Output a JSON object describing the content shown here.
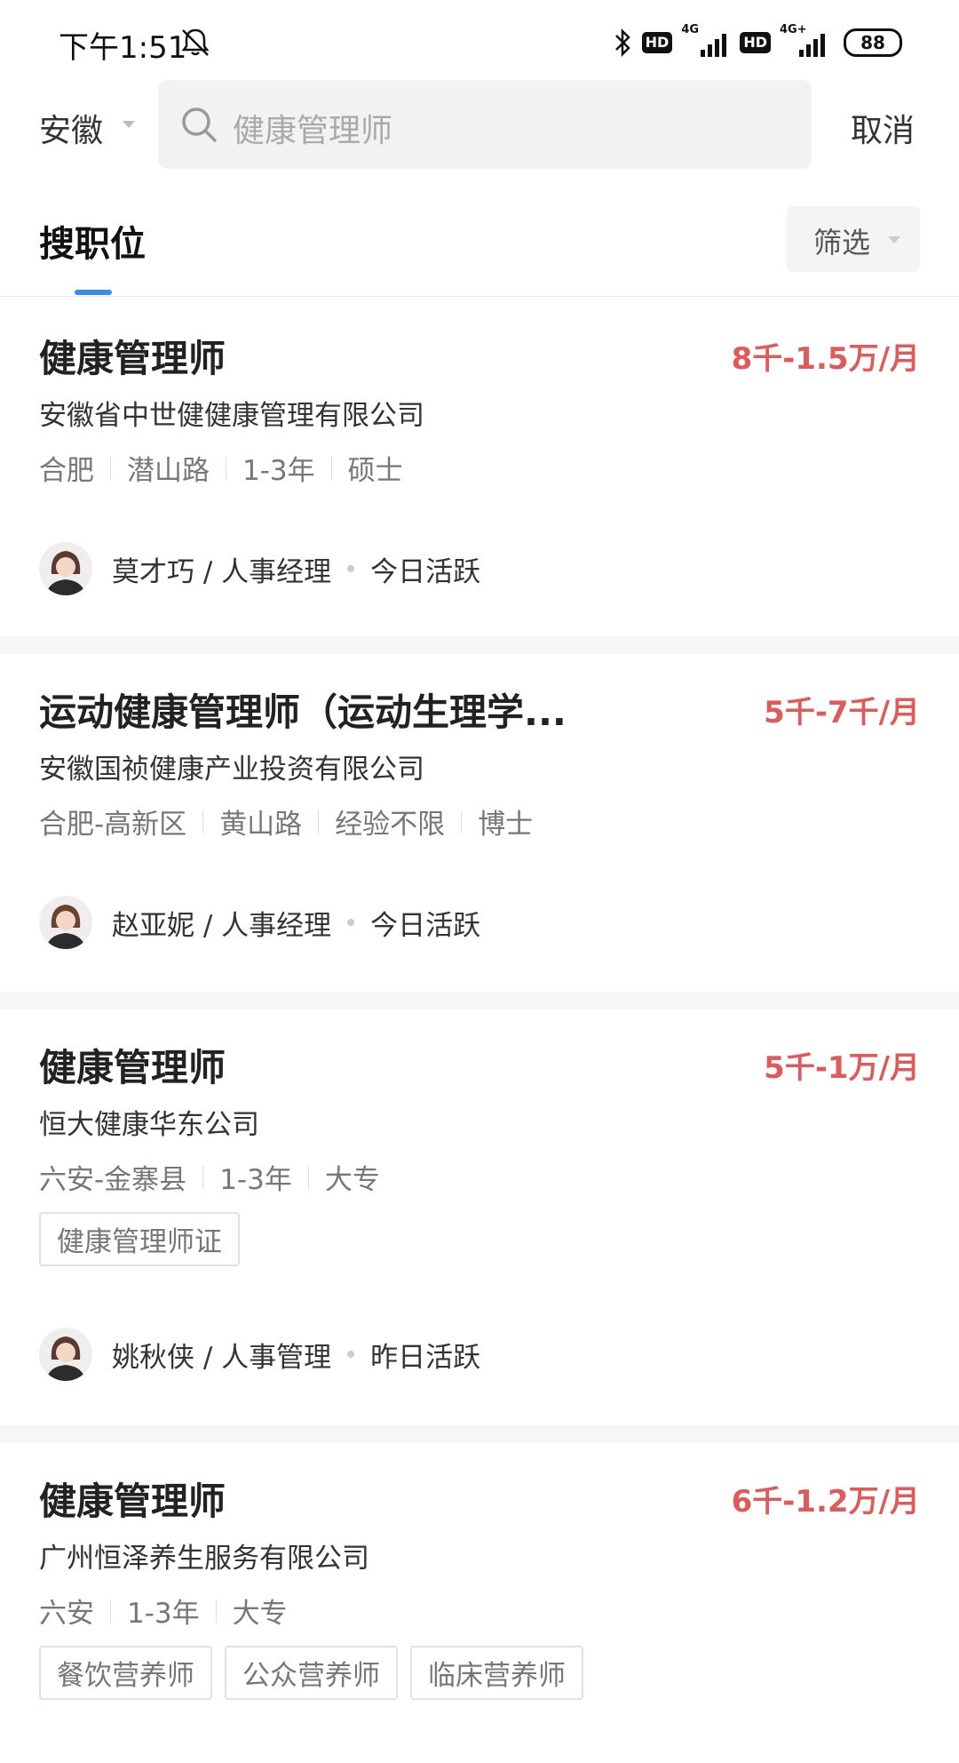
{
  "status_bar": {
    "time": "下午1:51",
    "hd_badge_1": "HD",
    "net_1": "4G",
    "hd_badge_2": "HD",
    "net_2": "4G+",
    "battery": "88"
  },
  "search": {
    "region": "安徽",
    "query": "健康管理师",
    "cancel_label": "取消"
  },
  "tabs": {
    "active_label": "搜职位",
    "filter_label": "筛选"
  },
  "jobs": [
    {
      "title": "健康管理师",
      "salary": "8千-1.5万/月",
      "company": "安徽省中世健健康管理有限公司",
      "tags": [
        "合肥",
        "潜山路",
        "1-3年",
        "硕士"
      ],
      "chips": [],
      "recruiter": "莫才巧 / 人事经理",
      "activity": "今日活跃"
    },
    {
      "title": "运动健康管理师（运动生理学...",
      "salary": "5千-7千/月",
      "company": "安徽国祯健康产业投资有限公司",
      "tags": [
        "合肥-高新区",
        "黄山路",
        "经验不限",
        "博士"
      ],
      "chips": [],
      "recruiter": "赵亚妮 / 人事经理",
      "activity": "今日活跃"
    },
    {
      "title": "健康管理师",
      "salary": "5千-1万/月",
      "company": "恒大健康华东公司",
      "tags": [
        "六安-金寨县",
        "1-3年",
        "大专"
      ],
      "chips": [
        "健康管理师证"
      ],
      "recruiter": "姚秋侠 / 人事管理",
      "activity": "昨日活跃"
    },
    {
      "title": "健康管理师",
      "salary": "6千-1.2万/月",
      "company": "广州恒泽养生服务有限公司",
      "tags": [
        "六安",
        "1-3年",
        "大专"
      ],
      "chips": [
        "餐饮营养师",
        "公众营养师",
        "临床营养师"
      ],
      "recruiter": "",
      "activity": ""
    }
  ],
  "colors": {
    "salary": "#e05a5a",
    "tab_indicator": "#3b8ee5"
  }
}
